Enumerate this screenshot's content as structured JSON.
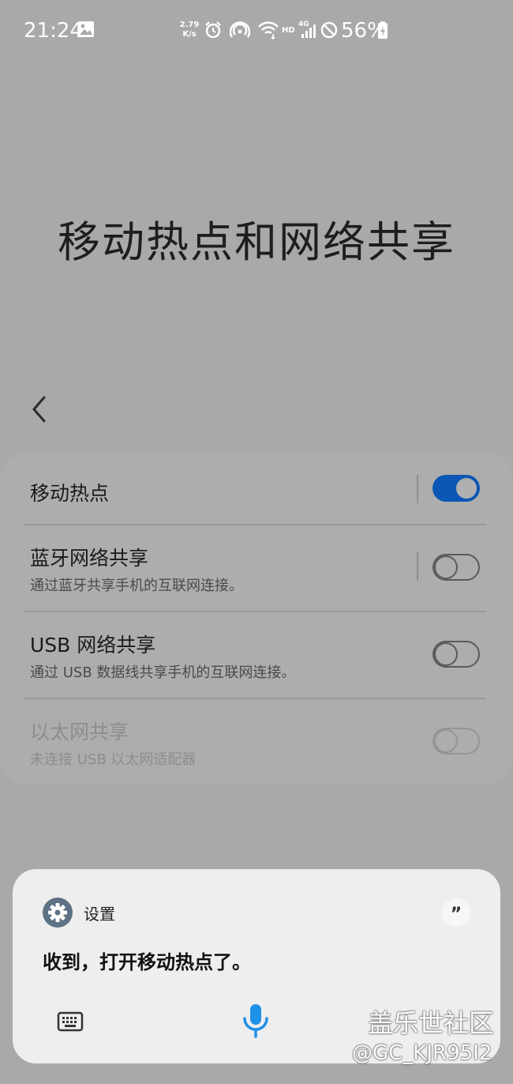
{
  "status_bar": {
    "time": "21:24",
    "net_speed_value": "2.79",
    "net_speed_unit": "K/s",
    "network_badge": "HD",
    "network_type": "4G",
    "battery": "56%"
  },
  "page": {
    "title": "移动热点和网络共享"
  },
  "settings": [
    {
      "title": "移动热点",
      "subtitle": "",
      "enabled": true,
      "toggle_on": true
    },
    {
      "title": "蓝牙网络共享",
      "subtitle": "通过蓝牙共享手机的互联网连接。",
      "enabled": true,
      "toggle_on": false
    },
    {
      "title": "USB 网络共享",
      "subtitle": "通过 USB 数据线共享手机的互联网连接。",
      "enabled": true,
      "toggle_on": false
    },
    {
      "title": "以太网共享",
      "subtitle": "未连接 USB 以太网适配器",
      "enabled": false,
      "toggle_on": false
    }
  ],
  "voice_panel": {
    "app_name": "设置",
    "response": "收到，打开移动热点了。",
    "quote_glyph": "”"
  },
  "watermark": {
    "line1": "盖乐世社区",
    "line2": "@GC_KJR95I2"
  },
  "colors": {
    "accent": "#0a57b5",
    "mic": "#1e90e8"
  }
}
